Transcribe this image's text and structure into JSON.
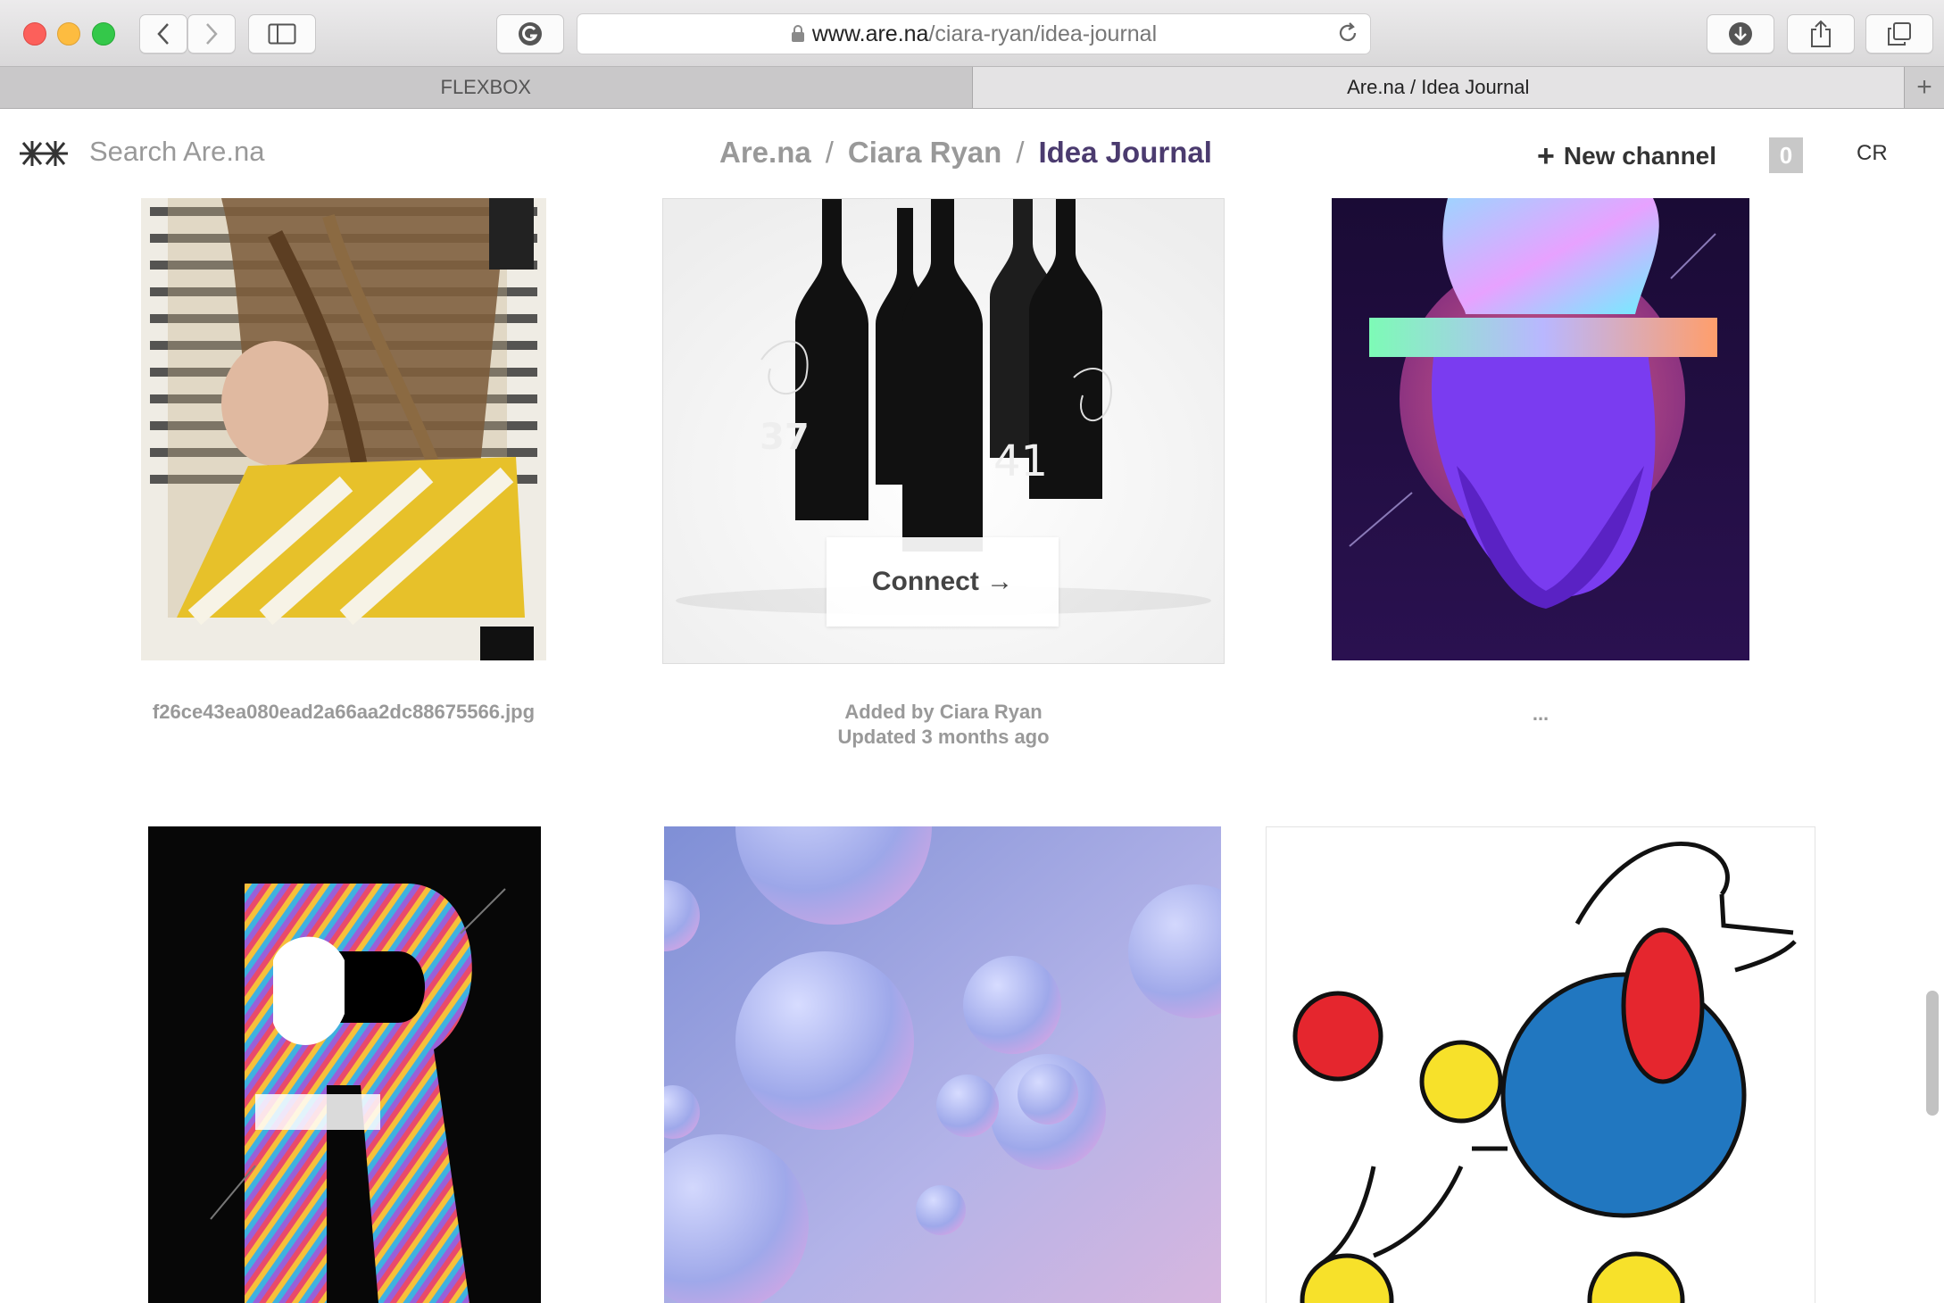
{
  "browser": {
    "url_host": "www.are.na",
    "url_path": "/ciara-ryan/idea-journal",
    "tabs": [
      {
        "label": "FLEXBOX",
        "active": false
      },
      {
        "label": "Are.na / Idea Journal",
        "active": true
      }
    ],
    "new_tab_symbol": "+"
  },
  "header": {
    "logo_icon": "arena-logo-icon",
    "search_placeholder": "Search Are.na",
    "breadcrumb": [
      "Are.na",
      "Ciara Ryan",
      "Idea Journal"
    ],
    "breadcrumb_separator": "/",
    "new_channel_label": "New channel",
    "notifications_count": "0",
    "user_initials": "CR"
  },
  "blocks": [
    {
      "type": "image",
      "description_icon": "collage-image",
      "caption_lines": [
        "f26ce43ea080ead2a66aa2dc88675566.jpg"
      ]
    },
    {
      "type": "image",
      "description_icon": "wine-bottles-image",
      "caption_lines": [
        "Added by Ciara Ryan",
        "Updated 3 months ago"
      ],
      "hover_action": "Connect →"
    },
    {
      "type": "image",
      "description_icon": "purple-bust-poster-image",
      "caption_lines": [
        "..."
      ]
    },
    {
      "type": "image",
      "description_icon": "letter-r-poster-image",
      "caption_lines": []
    },
    {
      "type": "image",
      "description_icon": "bubbles-image",
      "caption_lines": []
    },
    {
      "type": "image",
      "description_icon": "abstract-figure-image",
      "caption_lines": []
    }
  ],
  "colors": {
    "breadcrumb_current": "#4b3b6f",
    "muted_text": "#999999",
    "badge_bg": "#c8c8c8"
  }
}
